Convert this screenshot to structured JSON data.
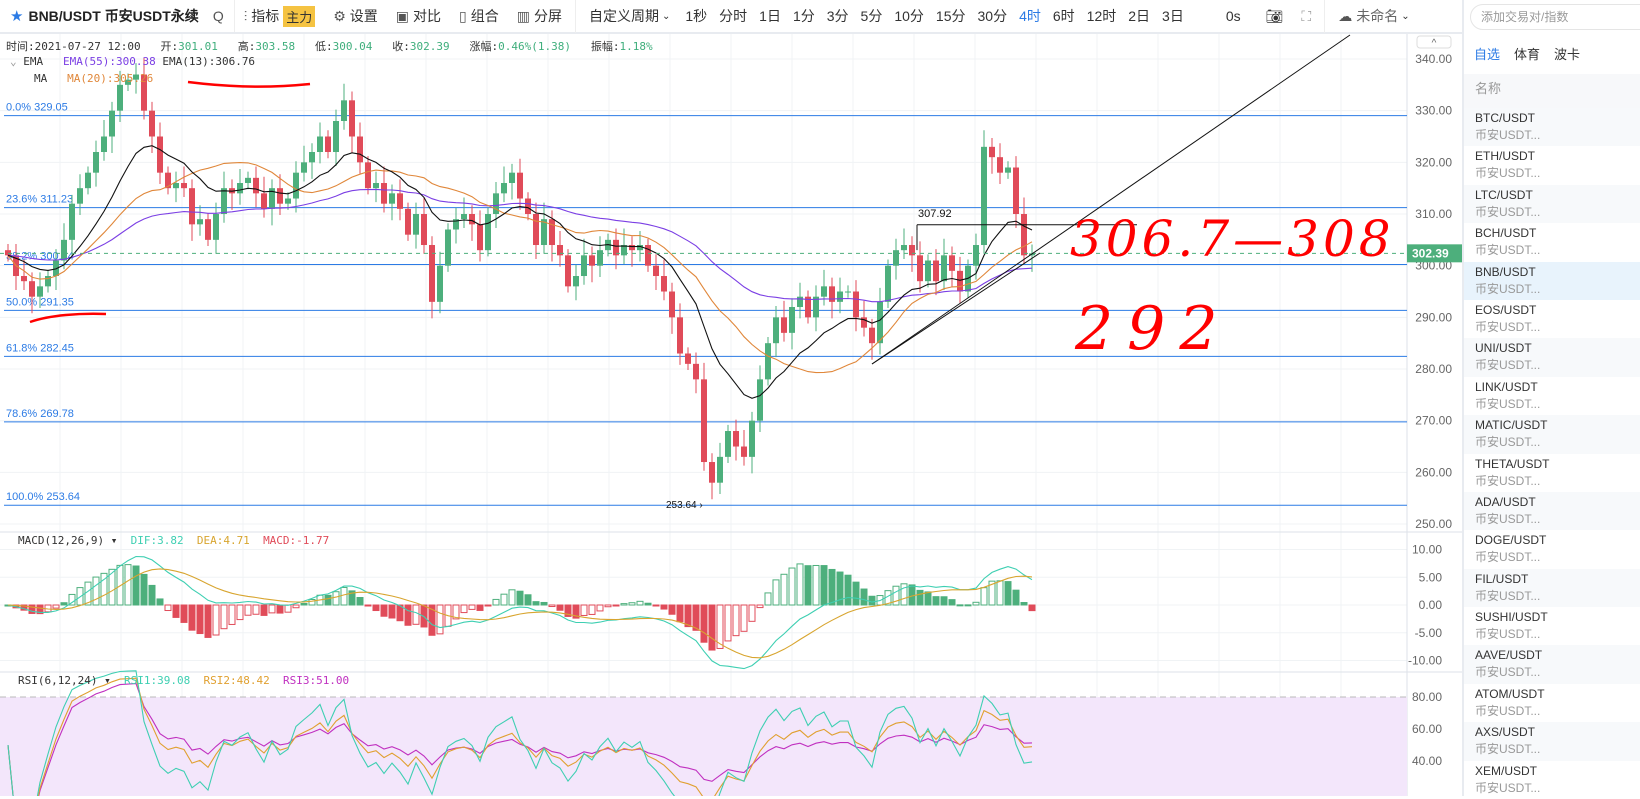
{
  "toolbar": {
    "symbol": "BNB/USDT",
    "market": "币安USDT永续",
    "indicators": "指标",
    "main_badge": "主力",
    "settings": "设置",
    "compare": "对比",
    "combine": "组合",
    "split": "分屏",
    "custom_period": "自定义周期",
    "periods": [
      "1秒",
      "分时",
      "1日",
      "1分",
      "3分",
      "5分",
      "10分",
      "15分",
      "30分",
      "4时",
      "6时",
      "12时",
      "2日",
      "3日"
    ],
    "active_period": "4时",
    "countdown": "0s",
    "layout_name": "未命名"
  },
  "info": {
    "time_label": "时间:",
    "time": "2021-07-27 12:00",
    "open_label": "开:",
    "open": "301.01",
    "high_label": "高:",
    "high": "303.58",
    "low_label": "低:",
    "low": "300.04",
    "close_label": "收:",
    "close": "302.39",
    "chg_label": "涨幅:",
    "chg": "0.46%(1.38)",
    "amp_label": "振幅:",
    "amp": "1.18%",
    "ema_name": "EMA",
    "ema55": "EMA(55):300.38",
    "ema13": "EMA(13):306.76",
    "ma_name": "MA",
    "ma20": "MA(20):305.26",
    "macd_name": "MACD(12,26,9)",
    "dif": "DIF:3.82",
    "dea": "DEA:4.71",
    "macd": "MACD:-1.77",
    "rsi_name": "RSI(6,12,24)",
    "rsi1": "RSI1:39.08",
    "rsi2": "RSI2:48.42",
    "rsi3": "RSI3:51.00"
  },
  "colors": {
    "up": "#4daf7c",
    "down": "#e04b59",
    "fib": "#2c7be5",
    "ema13": "#111111",
    "ma20": "#e0873a",
    "ema55": "#7b3fe4",
    "dif": "#3ecfb2",
    "dea": "#d8a52f",
    "rsi1": "#3ecfb2",
    "rsi2": "#e0a030",
    "rsi3": "#c030c0",
    "accent": "#2c7be5",
    "annotation": "#ff0000"
  },
  "chart_data": {
    "type": "candlestick",
    "price_axis": [
      "340.00",
      "330.00",
      "320.00",
      "310.00",
      "300.00",
      "290.00",
      "280.00",
      "270.00",
      "260.00",
      "250.00"
    ],
    "price_range": [
      250,
      340
    ],
    "last_price": "302.39",
    "macd_axis": [
      "10.00",
      "5.00",
      "0.00",
      "-5.00",
      "-10.00"
    ],
    "rsi_axis": [
      "80.00",
      "60.00",
      "40.00"
    ],
    "fib_levels": [
      {
        "label": "0.0% 329.05",
        "value": 329.05
      },
      {
        "label": "23.6% 311.23",
        "value": 311.23
      },
      {
        "label": "38.2% 300.24",
        "value": 300.24
      },
      {
        "label": "50.0% 291.35",
        "value": 291.35
      },
      {
        "label": "61.8% 282.45",
        "value": 282.45
      },
      {
        "label": "78.6% 269.78",
        "value": 269.78
      },
      {
        "label": "100.0% 253.64",
        "value": 253.64
      }
    ],
    "low_marker": "253.64 ›",
    "box_label": "307.92",
    "box_value": 307.92,
    "closes": [
      302,
      298,
      297,
      294,
      296,
      298,
      301,
      305,
      312,
      315,
      318,
      322,
      325,
      330,
      335,
      336,
      337,
      330,
      325,
      318,
      315,
      316,
      315,
      308,
      309,
      305,
      310,
      315,
      314,
      316,
      317,
      314,
      311,
      315,
      312,
      313,
      318,
      320,
      322,
      325,
      322,
      328,
      332,
      325,
      320,
      315,
      316,
      312,
      314,
      311,
      306,
      310,
      304,
      293,
      300,
      307,
      309,
      310,
      308,
      303,
      310,
      314,
      316,
      318,
      313,
      310,
      304,
      309,
      304,
      302,
      296,
      298,
      302,
      300,
      303,
      305,
      302,
      304,
      303,
      304,
      300,
      298,
      295,
      290,
      283,
      281,
      278,
      262,
      258,
      263,
      268,
      265,
      263,
      270,
      278,
      285,
      290,
      287,
      292,
      294,
      290,
      294,
      296,
      293,
      295,
      295,
      290,
      288,
      285,
      293,
      300,
      303,
      304,
      302,
      297,
      301,
      297,
      302,
      299,
      295,
      300,
      304,
      323,
      321,
      318,
      319,
      310,
      302,
      302.39
    ]
  },
  "annotations": {
    "range": "306.7—308",
    "support": "292"
  },
  "sidebar": {
    "search_placeholder": "添加交易对/指数",
    "tabs": [
      "自选",
      "体育",
      "波卡"
    ],
    "header": "名称",
    "items": [
      {
        "name": "BTC/USDT",
        "sub": "币安USDT..."
      },
      {
        "name": "ETH/USDT",
        "sub": "币安USDT..."
      },
      {
        "name": "LTC/USDT",
        "sub": "币安USDT..."
      },
      {
        "name": "BCH/USDT",
        "sub": "币安USDT..."
      },
      {
        "name": "BNB/USDT",
        "sub": "币安USDT..."
      },
      {
        "name": "EOS/USDT",
        "sub": "币安USDT..."
      },
      {
        "name": "UNI/USDT",
        "sub": "币安USDT..."
      },
      {
        "name": "LINK/USDT",
        "sub": "币安USDT..."
      },
      {
        "name": "MATIC/USDT",
        "sub": "币安USDT..."
      },
      {
        "name": "THETA/USDT",
        "sub": "币安USDT..."
      },
      {
        "name": "ADA/USDT",
        "sub": "币安USDT..."
      },
      {
        "name": "DOGE/USDT",
        "sub": "币安USDT..."
      },
      {
        "name": "FIL/USDT",
        "sub": "币安USDT..."
      },
      {
        "name": "SUSHI/USDT",
        "sub": "币安USDT..."
      },
      {
        "name": "AAVE/USDT",
        "sub": "币安USDT..."
      },
      {
        "name": "ATOM/USDT",
        "sub": "币安USDT..."
      },
      {
        "name": "AXS/USDT",
        "sub": "币安USDT..."
      },
      {
        "name": "XEM/USDT",
        "sub": "币安USDT..."
      }
    ]
  }
}
